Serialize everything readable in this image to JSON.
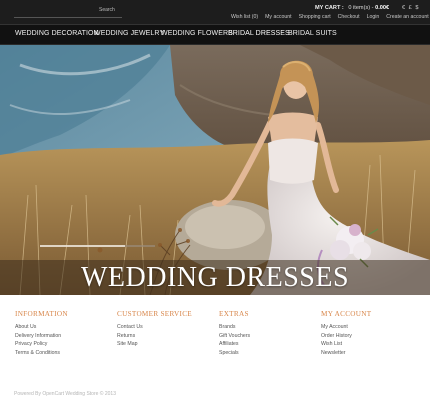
{
  "topbar": {
    "search": {
      "placeholder": "",
      "button_label": "Search"
    },
    "cart": {
      "label": "MY CART :",
      "items": "0 item(s) -",
      "total": "0.00€"
    },
    "currency": "€ £ $",
    "account_links": [
      "Wish list (0)",
      "My account",
      "Shopping cart",
      "Checkout",
      "Login",
      "Create an account"
    ]
  },
  "nav": {
    "items": [
      "WEDDING DECORATION",
      "WEDDING JEWELRY",
      "WEDDING FLOWERS",
      "BRIDAL DRESSES",
      "BRIDAL SUITS"
    ]
  },
  "hero": {
    "caption": "WEDDING DRESSES"
  },
  "footer": {
    "columns": [
      {
        "title": "INFORMATION",
        "links": [
          "About Us",
          "Delivery Information",
          "Privacy Policy",
          "Terms & Conditions"
        ]
      },
      {
        "title": "CUSTOMER SERVICE",
        "links": [
          "Contact Us",
          "Returns",
          "Site Map"
        ]
      },
      {
        "title": "EXTRAS",
        "links": [
          "Brands",
          "Gift Vouchers",
          "Affiliates",
          "Specials"
        ]
      },
      {
        "title": "MY ACCOUNT",
        "links": [
          "My Account",
          "Order History",
          "Wish List",
          "Newsletter"
        ]
      }
    ],
    "copyright": "Powered By OpenCart Wedding Store © 2013"
  },
  "colors": {
    "topbar_bg": "#1d1d1d",
    "nav_bg": "#111111",
    "footer_title": "#d8864a",
    "caption_text": "#ffffff"
  }
}
